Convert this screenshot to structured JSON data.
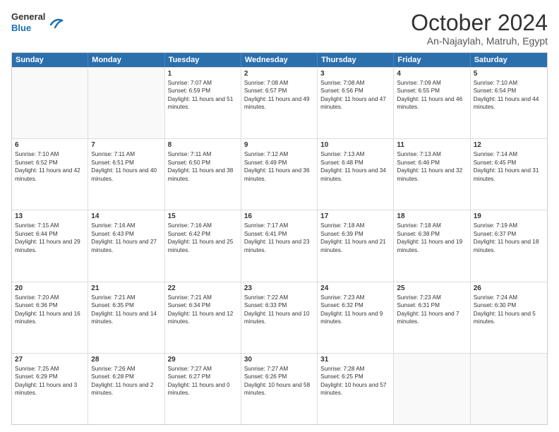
{
  "header": {
    "logo_general": "General",
    "logo_blue": "Blue",
    "month": "October 2024",
    "location": "An-Najaylah, Matruh, Egypt"
  },
  "days_of_week": [
    "Sunday",
    "Monday",
    "Tuesday",
    "Wednesday",
    "Thursday",
    "Friday",
    "Saturday"
  ],
  "weeks": [
    [
      {
        "day": "",
        "sunrise": "",
        "sunset": "",
        "daylight": "",
        "empty": true
      },
      {
        "day": "",
        "sunrise": "",
        "sunset": "",
        "daylight": "",
        "empty": true
      },
      {
        "day": "1",
        "sunrise": "Sunrise: 7:07 AM",
        "sunset": "Sunset: 6:59 PM",
        "daylight": "Daylight: 11 hours and 51 minutes."
      },
      {
        "day": "2",
        "sunrise": "Sunrise: 7:08 AM",
        "sunset": "Sunset: 6:57 PM",
        "daylight": "Daylight: 11 hours and 49 minutes."
      },
      {
        "day": "3",
        "sunrise": "Sunrise: 7:08 AM",
        "sunset": "Sunset: 6:56 PM",
        "daylight": "Daylight: 11 hours and 47 minutes."
      },
      {
        "day": "4",
        "sunrise": "Sunrise: 7:09 AM",
        "sunset": "Sunset: 6:55 PM",
        "daylight": "Daylight: 11 hours and 46 minutes."
      },
      {
        "day": "5",
        "sunrise": "Sunrise: 7:10 AM",
        "sunset": "Sunset: 6:54 PM",
        "daylight": "Daylight: 11 hours and 44 minutes."
      }
    ],
    [
      {
        "day": "6",
        "sunrise": "Sunrise: 7:10 AM",
        "sunset": "Sunset: 6:52 PM",
        "daylight": "Daylight: 11 hours and 42 minutes."
      },
      {
        "day": "7",
        "sunrise": "Sunrise: 7:11 AM",
        "sunset": "Sunset: 6:51 PM",
        "daylight": "Daylight: 11 hours and 40 minutes."
      },
      {
        "day": "8",
        "sunrise": "Sunrise: 7:11 AM",
        "sunset": "Sunset: 6:50 PM",
        "daylight": "Daylight: 11 hours and 38 minutes."
      },
      {
        "day": "9",
        "sunrise": "Sunrise: 7:12 AM",
        "sunset": "Sunset: 6:49 PM",
        "daylight": "Daylight: 11 hours and 36 minutes."
      },
      {
        "day": "10",
        "sunrise": "Sunrise: 7:13 AM",
        "sunset": "Sunset: 6:48 PM",
        "daylight": "Daylight: 11 hours and 34 minutes."
      },
      {
        "day": "11",
        "sunrise": "Sunrise: 7:13 AM",
        "sunset": "Sunset: 6:46 PM",
        "daylight": "Daylight: 11 hours and 32 minutes."
      },
      {
        "day": "12",
        "sunrise": "Sunrise: 7:14 AM",
        "sunset": "Sunset: 6:45 PM",
        "daylight": "Daylight: 11 hours and 31 minutes."
      }
    ],
    [
      {
        "day": "13",
        "sunrise": "Sunrise: 7:15 AM",
        "sunset": "Sunset: 6:44 PM",
        "daylight": "Daylight: 11 hours and 29 minutes."
      },
      {
        "day": "14",
        "sunrise": "Sunrise: 7:16 AM",
        "sunset": "Sunset: 6:43 PM",
        "daylight": "Daylight: 11 hours and 27 minutes."
      },
      {
        "day": "15",
        "sunrise": "Sunrise: 7:16 AM",
        "sunset": "Sunset: 6:42 PM",
        "daylight": "Daylight: 11 hours and 25 minutes."
      },
      {
        "day": "16",
        "sunrise": "Sunrise: 7:17 AM",
        "sunset": "Sunset: 6:41 PM",
        "daylight": "Daylight: 11 hours and 23 minutes."
      },
      {
        "day": "17",
        "sunrise": "Sunrise: 7:18 AM",
        "sunset": "Sunset: 6:39 PM",
        "daylight": "Daylight: 11 hours and 21 minutes."
      },
      {
        "day": "18",
        "sunrise": "Sunrise: 7:18 AM",
        "sunset": "Sunset: 6:38 PM",
        "daylight": "Daylight: 11 hours and 19 minutes."
      },
      {
        "day": "19",
        "sunrise": "Sunrise: 7:19 AM",
        "sunset": "Sunset: 6:37 PM",
        "daylight": "Daylight: 11 hours and 18 minutes."
      }
    ],
    [
      {
        "day": "20",
        "sunrise": "Sunrise: 7:20 AM",
        "sunset": "Sunset: 6:36 PM",
        "daylight": "Daylight: 11 hours and 16 minutes."
      },
      {
        "day": "21",
        "sunrise": "Sunrise: 7:21 AM",
        "sunset": "Sunset: 6:35 PM",
        "daylight": "Daylight: 11 hours and 14 minutes."
      },
      {
        "day": "22",
        "sunrise": "Sunrise: 7:21 AM",
        "sunset": "Sunset: 6:34 PM",
        "daylight": "Daylight: 11 hours and 12 minutes."
      },
      {
        "day": "23",
        "sunrise": "Sunrise: 7:22 AM",
        "sunset": "Sunset: 6:33 PM",
        "daylight": "Daylight: 11 hours and 10 minutes."
      },
      {
        "day": "24",
        "sunrise": "Sunrise: 7:23 AM",
        "sunset": "Sunset: 6:32 PM",
        "daylight": "Daylight: 11 hours and 9 minutes."
      },
      {
        "day": "25",
        "sunrise": "Sunrise: 7:23 AM",
        "sunset": "Sunset: 6:31 PM",
        "daylight": "Daylight: 11 hours and 7 minutes."
      },
      {
        "day": "26",
        "sunrise": "Sunrise: 7:24 AM",
        "sunset": "Sunset: 6:30 PM",
        "daylight": "Daylight: 11 hours and 5 minutes."
      }
    ],
    [
      {
        "day": "27",
        "sunrise": "Sunrise: 7:25 AM",
        "sunset": "Sunset: 6:29 PM",
        "daylight": "Daylight: 11 hours and 3 minutes."
      },
      {
        "day": "28",
        "sunrise": "Sunrise: 7:26 AM",
        "sunset": "Sunset: 6:28 PM",
        "daylight": "Daylight: 11 hours and 2 minutes."
      },
      {
        "day": "29",
        "sunrise": "Sunrise: 7:27 AM",
        "sunset": "Sunset: 6:27 PM",
        "daylight": "Daylight: 11 hours and 0 minutes."
      },
      {
        "day": "30",
        "sunrise": "Sunrise: 7:27 AM",
        "sunset": "Sunset: 6:26 PM",
        "daylight": "Daylight: 10 hours and 58 minutes."
      },
      {
        "day": "31",
        "sunrise": "Sunrise: 7:28 AM",
        "sunset": "Sunset: 6:25 PM",
        "daylight": "Daylight: 10 hours and 57 minutes."
      },
      {
        "day": "",
        "sunrise": "",
        "sunset": "",
        "daylight": "",
        "empty": true
      },
      {
        "day": "",
        "sunrise": "",
        "sunset": "",
        "daylight": "",
        "empty": true
      }
    ]
  ]
}
